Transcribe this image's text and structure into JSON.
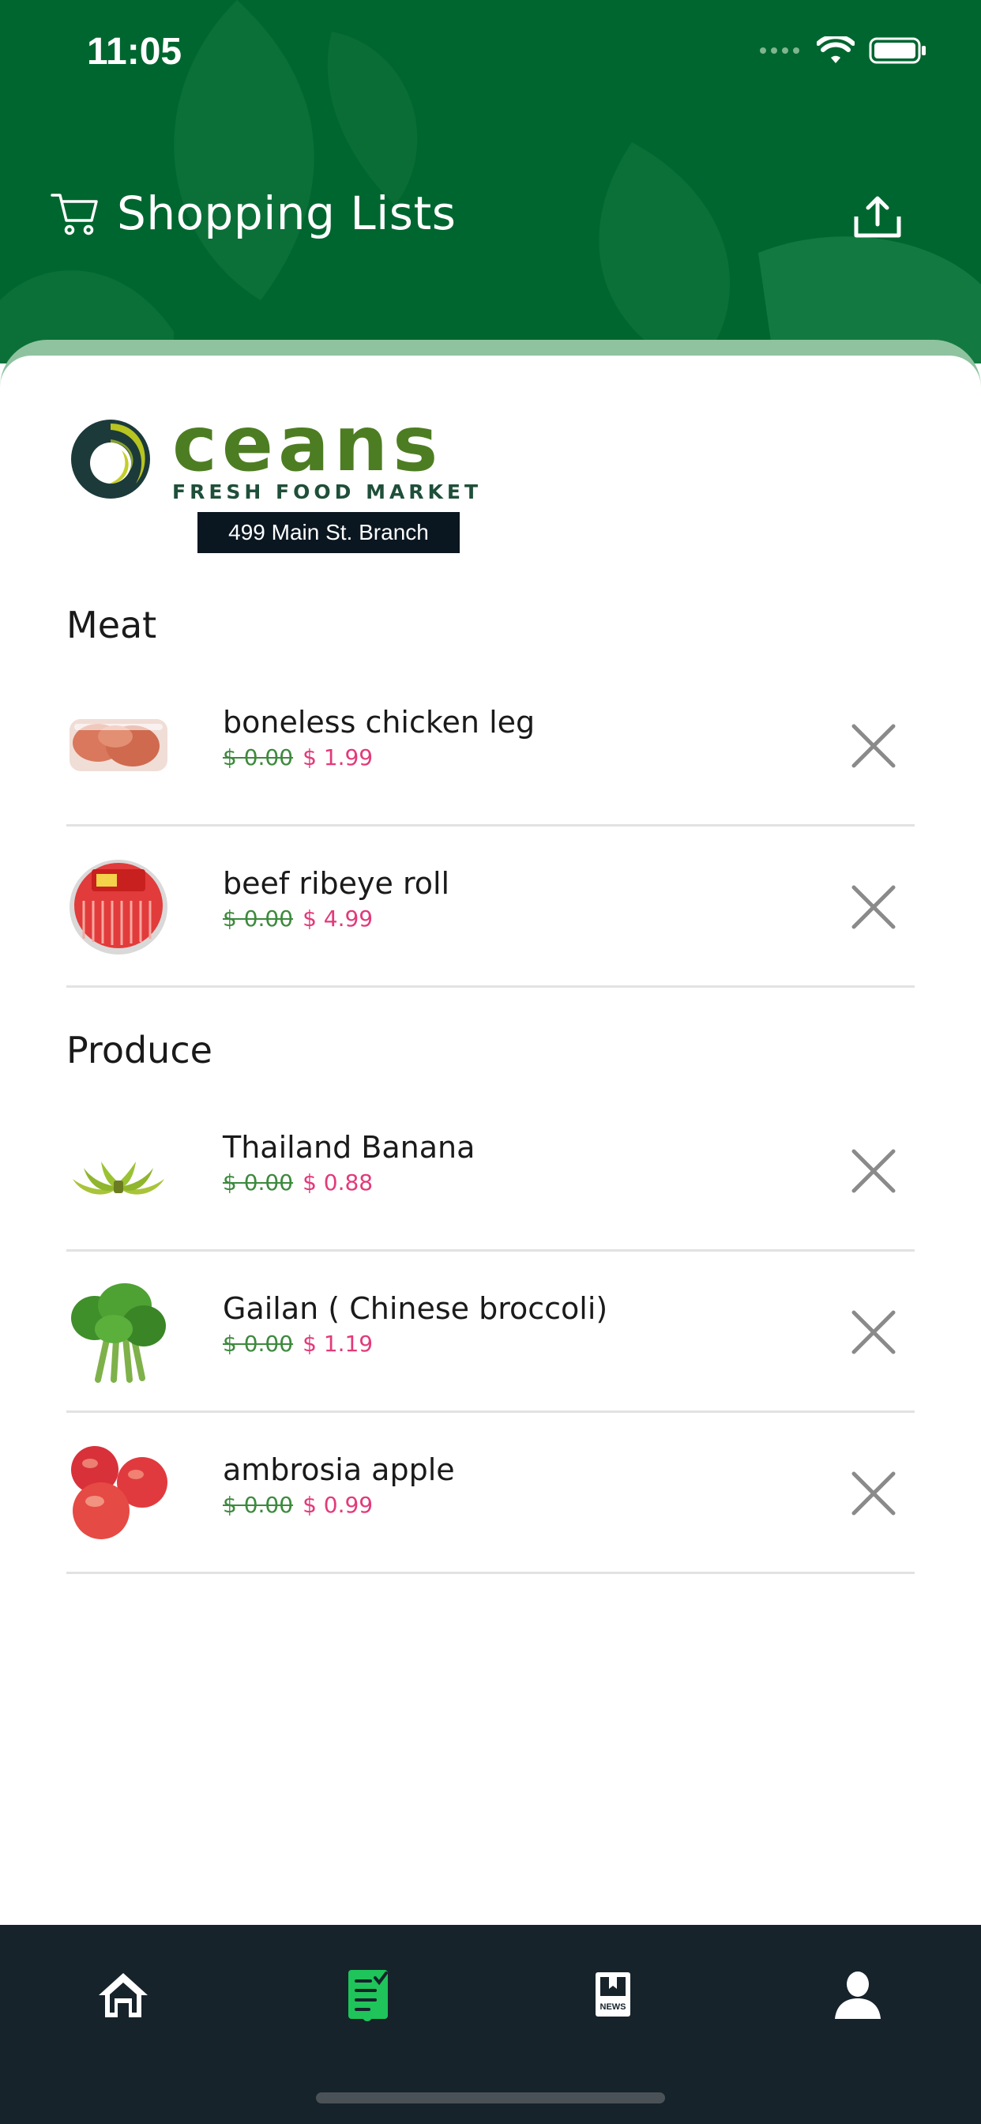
{
  "status_bar": {
    "time": "11:05"
  },
  "header": {
    "title": "Shopping Lists",
    "cart_icon": "cart-icon",
    "share_icon": "share-icon",
    "background_color": "#00662f"
  },
  "store": {
    "logo_name": "ceans",
    "logo_subtitle": "FRESH FOOD MARKET",
    "branch": "499 Main St. Branch"
  },
  "sections": [
    {
      "title": "Meat",
      "items": [
        {
          "name": "boneless chicken leg",
          "old_price": "$ 0.00",
          "price": "$ 1.99"
        },
        {
          "name": "beef ribeye roll",
          "old_price": "$ 0.00",
          "price": "$ 4.99"
        }
      ]
    },
    {
      "title": "Produce",
      "items": [
        {
          "name": "Thailand Banana",
          "old_price": "$ 0.00",
          "price": "$ 0.88"
        },
        {
          "name": "Gailan ( Chinese broccoli)",
          "old_price": "$ 0.00",
          "price": "$ 1.19"
        },
        {
          "name": "ambrosia apple",
          "old_price": "$ 0.00",
          "price": "$ 0.99"
        }
      ]
    }
  ],
  "tabs": [
    {
      "icon": "home-icon",
      "active": false
    },
    {
      "icon": "shopping-list-icon",
      "active": true
    },
    {
      "icon": "news-icon",
      "active": false
    },
    {
      "icon": "profile-icon",
      "active": false
    }
  ],
  "colors": {
    "accent": "#1fc45a",
    "sale_price": "#e23a7a",
    "old_price": "#3d8a3d",
    "tabbar": "#16232b"
  }
}
